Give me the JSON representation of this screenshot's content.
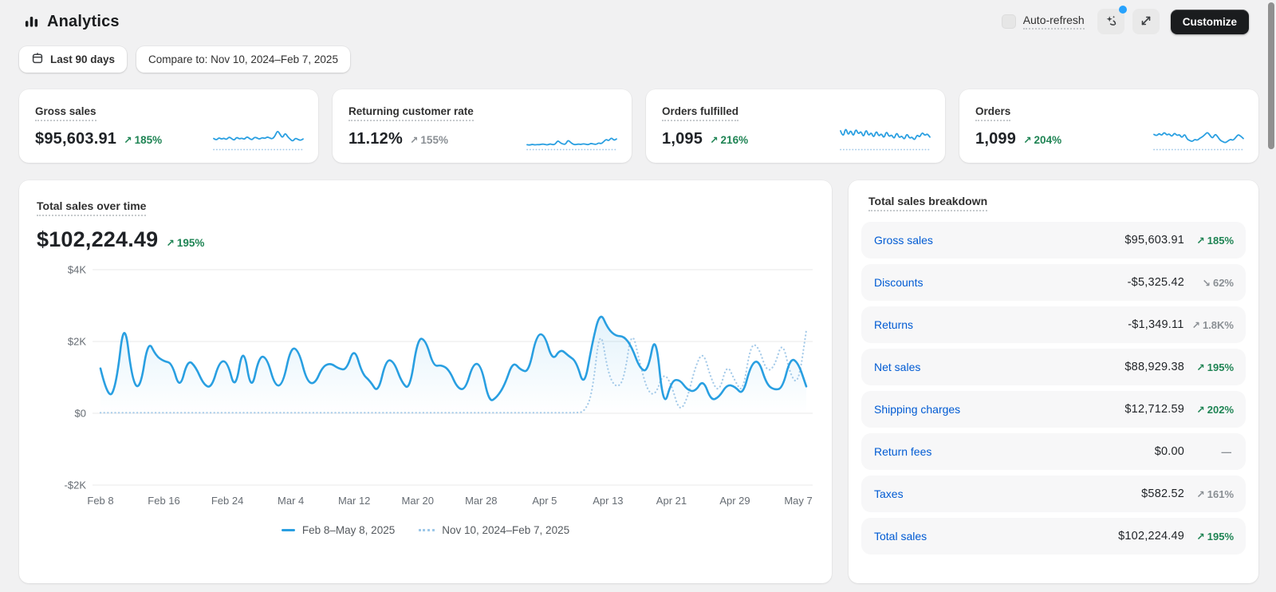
{
  "header": {
    "title": "Analytics",
    "auto_refresh_label": "Auto-refresh",
    "auto_refresh_checked": false,
    "customize_label": "Customize"
  },
  "filters": {
    "date_range": "Last 90 days",
    "compare_to": "Compare to: Nov 10, 2024–Feb 7, 2025"
  },
  "metric_cards": [
    {
      "title": "Gross sales",
      "value": "$95,603.91",
      "arrow": "↗",
      "delta": "185%",
      "tone": "up",
      "sparkline": [
        38,
        30,
        42,
        35,
        40,
        33,
        45,
        38,
        30,
        44,
        36,
        40,
        34,
        46,
        38,
        32,
        44,
        40,
        35,
        42,
        38,
        45,
        40,
        36,
        48,
        72,
        55,
        40,
        62,
        45,
        35,
        26,
        40,
        34,
        30,
        36
      ]
    },
    {
      "title": "Returning customer rate",
      "value": "11.12%",
      "arrow": "↗",
      "delta": "155%",
      "tone": "neutral",
      "sparkline": [
        12,
        10,
        14,
        11,
        13,
        12,
        15,
        13,
        11,
        16,
        12,
        14,
        30,
        20,
        15,
        13,
        32,
        22,
        14,
        12,
        15,
        13,
        16,
        14,
        12,
        18,
        15,
        13,
        20,
        16,
        25,
        35,
        28,
        42,
        30,
        36
      ]
    },
    {
      "title": "Orders fulfilled",
      "value": "1,095",
      "arrow": "↗",
      "delta": "216%",
      "tone": "up",
      "sparkline": [
        70,
        40,
        85,
        50,
        75,
        45,
        80,
        55,
        70,
        42,
        78,
        48,
        65,
        40,
        72,
        46,
        60,
        38,
        70,
        44,
        55,
        35,
        65,
        40,
        50,
        32,
        60,
        38,
        45,
        30,
        55,
        42,
        65,
        50,
        58,
        44
      ]
    },
    {
      "title": "Orders",
      "value": "1,099",
      "arrow": "↗",
      "delta": "204%",
      "tone": "up",
      "sparkline": [
        55,
        48,
        60,
        50,
        65,
        52,
        58,
        45,
        62,
        50,
        55,
        40,
        58,
        35,
        30,
        25,
        35,
        30,
        40,
        45,
        55,
        65,
        50,
        38,
        58,
        45,
        30,
        25,
        20,
        28,
        35,
        30,
        42,
        55,
        48,
        38
      ]
    }
  ],
  "chart_card": {
    "title": "Total sales over time",
    "value": "$102,224.49",
    "arrow": "↗",
    "delta": "195%",
    "tone": "up"
  },
  "chart_data": {
    "type": "line",
    "title": "Total sales over time",
    "unit": "USD",
    "ylim": [
      -2000,
      4000
    ],
    "y_tick_values": [
      4000,
      2000,
      0,
      -2000
    ],
    "y_ticks": [
      "$4K",
      "$2K",
      "$0",
      "-$2K"
    ],
    "x_ticks": [
      "Feb 8",
      "Feb 16",
      "Feb 24",
      "Mar 4",
      "Mar 12",
      "Mar 20",
      "Mar 28",
      "Apr 5",
      "Apr 13",
      "Apr 21",
      "Apr 29",
      "May 7"
    ],
    "x_tick_interval_days": 8,
    "grid": true,
    "legend_position": "bottom",
    "series": [
      {
        "name": "Feb 8–May 8, 2025",
        "style": "solid",
        "color": "#299fe1",
        "values": [
          1250,
          350,
          800,
          2700,
          900,
          650,
          2050,
          1600,
          1450,
          1400,
          650,
          1500,
          1300,
          800,
          700,
          1450,
          1450,
          600,
          1950,
          550,
          1600,
          1550,
          750,
          800,
          1850,
          1750,
          900,
          800,
          1300,
          1400,
          1250,
          1200,
          1850,
          1100,
          900,
          550,
          1500,
          1450,
          850,
          650,
          2100,
          2050,
          1300,
          1350,
          1200,
          700,
          650,
          1400,
          1350,
          300,
          450,
          800,
          1450,
          1200,
          1150,
          2200,
          2200,
          1450,
          1800,
          1600,
          1450,
          700,
          1950,
          2850,
          2350,
          2150,
          2150,
          1850,
          1250,
          1150,
          2300,
          100,
          900,
          950,
          650,
          600,
          950,
          350,
          450,
          800,
          750,
          500,
          1350,
          1500,
          800,
          650,
          700,
          1550,
          1400,
          750
        ]
      },
      {
        "name": "Nov 10, 2024–Feb 7, 2025",
        "style": "dotted",
        "color": "#a6cbe9",
        "values": [
          15,
          15,
          15,
          15,
          15,
          15,
          15,
          15,
          15,
          15,
          15,
          15,
          15,
          15,
          15,
          15,
          15,
          15,
          15,
          15,
          15,
          15,
          15,
          15,
          15,
          15,
          15,
          15,
          15,
          15,
          15,
          15,
          15,
          15,
          15,
          15,
          15,
          15,
          15,
          15,
          15,
          15,
          15,
          15,
          15,
          15,
          15,
          15,
          15,
          15,
          15,
          15,
          15,
          15,
          15,
          15,
          15,
          15,
          15,
          15,
          15,
          40,
          500,
          2500,
          1100,
          700,
          900,
          2400,
          1400,
          600,
          500,
          1150,
          800,
          30,
          400,
          1300,
          1750,
          950,
          550,
          1400,
          900,
          550,
          1950,
          1850,
          1150,
          1300,
          2050,
          1050,
          800,
          2300
        ]
      }
    ]
  },
  "breakdown": {
    "title": "Total sales breakdown",
    "rows": [
      {
        "label": "Gross sales",
        "amount": "$95,603.91",
        "arrow": "↗",
        "delta": "185%",
        "tone": "up"
      },
      {
        "label": "Discounts",
        "amount": "-$5,325.42",
        "arrow": "↘",
        "delta": "62%",
        "tone": "neutral"
      },
      {
        "label": "Returns",
        "amount": "-$1,349.11",
        "arrow": "↗",
        "delta": "1.8K%",
        "tone": "neutral"
      },
      {
        "label": "Net sales",
        "amount": "$88,929.38",
        "arrow": "↗",
        "delta": "195%",
        "tone": "up"
      },
      {
        "label": "Shipping charges",
        "amount": "$12,712.59",
        "arrow": "↗",
        "delta": "202%",
        "tone": "up"
      },
      {
        "label": "Return fees",
        "amount": "$0.00",
        "arrow": "—",
        "delta": "",
        "tone": "neutral"
      },
      {
        "label": "Taxes",
        "amount": "$582.52",
        "arrow": "↗",
        "delta": "161%",
        "tone": "neutral"
      },
      {
        "label": "Total sales",
        "amount": "$102,224.49",
        "arrow": "↗",
        "delta": "195%",
        "tone": "up"
      }
    ]
  },
  "colors": {
    "accent_blue": "#299fe1",
    "comparison_blue": "#a6cbe9",
    "link_blue": "#005bd3",
    "positive_green": "#1f8454",
    "neutral_gray": "#8a8f94",
    "customize_button_bg": "#1a1c1e",
    "notification_dot": "#27a2fd",
    "page_bg": "#f1f1f2",
    "grid_line": "#e8e8e8"
  }
}
